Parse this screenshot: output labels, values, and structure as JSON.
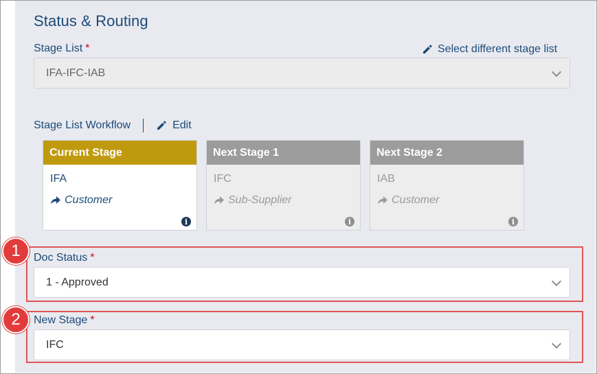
{
  "section": {
    "title": "Status & Routing"
  },
  "stage_list": {
    "label": "Stage List",
    "required": "*",
    "select_different_label": "Select different stage list",
    "value": "IFA-IFC-IAB"
  },
  "workflow": {
    "label": "Stage List Workflow",
    "edit_label": "Edit",
    "stages": [
      {
        "header": "Current Stage",
        "name": "IFA",
        "route": "Customer"
      },
      {
        "header": "Next Stage 1",
        "name": "IFC",
        "route": "Sub-Supplier"
      },
      {
        "header": "Next Stage 2",
        "name": "IAB",
        "route": "Customer"
      }
    ]
  },
  "doc_status": {
    "label": "Doc Status",
    "required": "*",
    "value": "1 - Approved",
    "badge": "1"
  },
  "new_stage": {
    "label": "New Stage",
    "required": "*",
    "value": "IFC",
    "badge": "2"
  },
  "colors": {
    "accent": "#1d4a78",
    "current_stage": "#c09a0e",
    "inactive_stage": "#9c9c9c",
    "highlight": "#e05353",
    "required": "#d0021b"
  },
  "icons": {
    "pencil": "pencil-icon",
    "share": "share-arrow-icon",
    "info": "info-icon",
    "chevron": "chevron-down-icon"
  }
}
